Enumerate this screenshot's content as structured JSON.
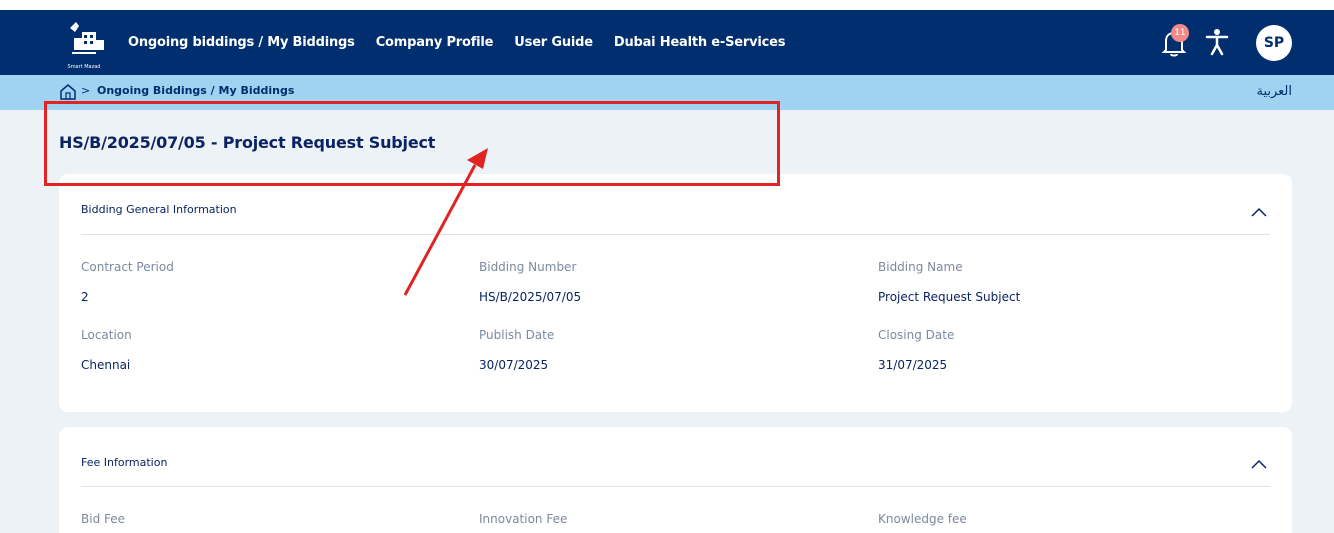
{
  "header": {
    "logo_text": "Smart Mazad",
    "nav": [
      {
        "label": "Ongoing biddings / My Biddings"
      },
      {
        "label": "Company Profile"
      },
      {
        "label": "User Guide"
      },
      {
        "label": "Dubai Health e-Services"
      }
    ],
    "notifications_count": "11",
    "avatar_initials": "SP"
  },
  "breadcrumb": {
    "separator": ">",
    "current": "Ongoing Biddings / My Biddings",
    "language_toggle": "العربية"
  },
  "page": {
    "title": "HS/B/2025/07/05 - Project Request Subject"
  },
  "general_info": {
    "title": "Bidding General Information",
    "fields": [
      {
        "label": "Contract Period",
        "value": "2"
      },
      {
        "label": "Bidding Number",
        "value": "HS/B/2025/07/05"
      },
      {
        "label": "Bidding Name",
        "value": "Project Request Subject"
      },
      {
        "label": "Location",
        "value": "Chennai"
      },
      {
        "label": "Publish Date",
        "value": "30/07/2025"
      },
      {
        "label": "Closing Date",
        "value": "31/07/2025"
      }
    ]
  },
  "fee_info": {
    "title": "Fee Information",
    "fields": [
      {
        "label": "Bid Fee"
      },
      {
        "label": "Innovation Fee"
      },
      {
        "label": "Knowledge fee"
      }
    ]
  },
  "colors": {
    "header_bg": "#002e6e",
    "breadcrumb_bg": "#9fd3f1",
    "content_bg": "#edf2f6",
    "annotation": "#e02424"
  }
}
